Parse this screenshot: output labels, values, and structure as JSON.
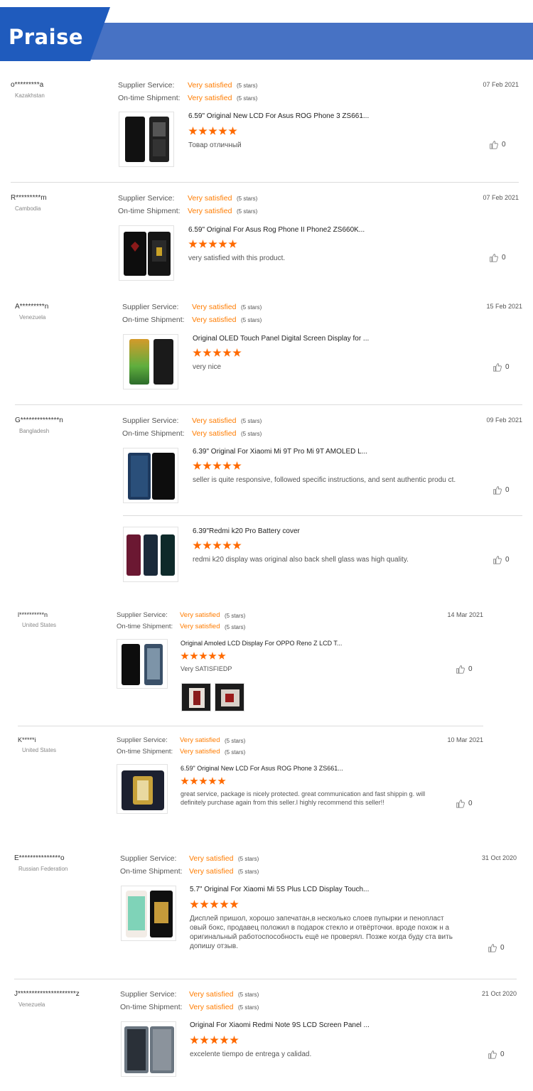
{
  "header": {
    "title": "Praise"
  },
  "labels": {
    "supplier": "Supplier Service:",
    "shipment": "On-time Shipment:"
  },
  "reviews": [
    {
      "user": "o*********a",
      "country": "Kazakhstan",
      "date": "07 Feb 2021",
      "supplier": "Very satisfied",
      "supplier_stars": "(5 stars)",
      "shipment": "Very satisfied",
      "shipment_stars": "(5 stars)",
      "products": [
        {
          "title": "6.59\" Original New LCD For Asus ROG Phone 3 ZS661...",
          "rating": 5,
          "comment": "Товар отличный",
          "likes": "0"
        }
      ]
    },
    {
      "user": "R*********m",
      "country": "Cambodia",
      "date": "07 Feb 2021",
      "supplier": "Very satisfied",
      "supplier_stars": "(5 stars)",
      "shipment": "Very satisfied",
      "shipment_stars": "(5 stars)",
      "products": [
        {
          "title": "6.59\" Original For Asus Rog Phone II Phone2 ZS660K...",
          "rating": 5,
          "comment": "very satisfied with this product.",
          "likes": "0"
        }
      ]
    },
    {
      "user": "A*********n",
      "country": "Venezuela",
      "date": "15 Feb 2021",
      "supplier": "Very satisfied",
      "supplier_stars": "(5 stars)",
      "shipment": "Very satisfied",
      "shipment_stars": "(5 stars)",
      "products": [
        {
          "title": "Original OLED Touch Panel Digital Screen Display for ...",
          "rating": 5,
          "comment": "very nice",
          "likes": "0"
        }
      ]
    },
    {
      "user": "G**************n",
      "country": "Bangladesh",
      "date": "09 Feb 2021",
      "supplier": "Very satisfied",
      "supplier_stars": "(5 stars)",
      "shipment": "Very satisfied",
      "shipment_stars": "(5 stars)",
      "products": [
        {
          "title": "6.39\" Original For Xiaomi Mi 9T Pro Mi 9T AMOLED L...",
          "rating": 5,
          "comment": "seller is quite responsive, followed specific instructions, and sent authentic produ ct.",
          "likes": "0"
        },
        {
          "title": "6.39\"Redmi k20 Pro Battery cover",
          "rating": 5,
          "comment": "redmi k20 display was original also back shell glass was high quality.",
          "likes": "0"
        }
      ]
    },
    {
      "user": "l**********n",
      "country": "United States",
      "date": "14 Mar 2021",
      "supplier": "Very satisfied",
      "supplier_stars": "(5 stars)",
      "shipment": "Very satisfied",
      "shipment_stars": "(5 stars)",
      "products": [
        {
          "title": "Original Amoled LCD Display For OPPO Reno Z LCD T...",
          "rating": 5,
          "comment": "Very SATISFIEDP",
          "likes": "0"
        }
      ]
    },
    {
      "user": "K*****i",
      "country": "United States",
      "date": "10 Mar 2021",
      "supplier": "Very satisfied",
      "supplier_stars": "(5 stars)",
      "shipment": "Very satisfied",
      "shipment_stars": "(5 stars)",
      "products": [
        {
          "title": "6.59\" Original New LCD For Asus ROG Phone 3 ZS661...",
          "rating": 5,
          "comment": "great service, package is nicely protected. great communication and fast shippin g. will definitely purchase again from this seller.I highly recommend this seller!!",
          "likes": "0"
        }
      ]
    },
    {
      "user": "E***************o",
      "country": "Russian Federation",
      "date": "31 Oct 2020",
      "supplier": "Very satisfied",
      "supplier_stars": "(5 stars)",
      "shipment": "Very satisfied",
      "shipment_stars": "(5 stars)",
      "products": [
        {
          "title": "5.7\" Original For Xiaomi Mi 5S Plus LCD Display Touch...",
          "rating": 5,
          "comment": "Дисплей пришол, хорошо запечатан,в несколько слоев пупырки и пенопласт овый бокс, продавец положил в подарок стекло и отвёрточки. вроде похож н а оригинальный работоспособность ещё не проверял. Позже когда буду ста вить допишу отзыв.",
          "likes": "0"
        }
      ]
    },
    {
      "user": "J*********************z",
      "country": "Venezuela",
      "date": "21 Oct 2020",
      "supplier": "Very satisfied",
      "supplier_stars": "(5 stars)",
      "shipment": "Very satisfied",
      "shipment_stars": "(5 stars)",
      "products": [
        {
          "title": "Original For Xiaomi Redmi Note 9S LCD Screen Panel ...",
          "rating": 5,
          "comment": "excelente tiempo de entrega y calidad.",
          "likes": "0"
        }
      ]
    }
  ],
  "icons": {
    "like": "thumbs-up-icon",
    "rating": "star-icon"
  },
  "colors": {
    "banner": "#4772c4",
    "banner_tab": "#1f5bbd",
    "accent": "#ff7c00",
    "star": "#ff6a00"
  }
}
